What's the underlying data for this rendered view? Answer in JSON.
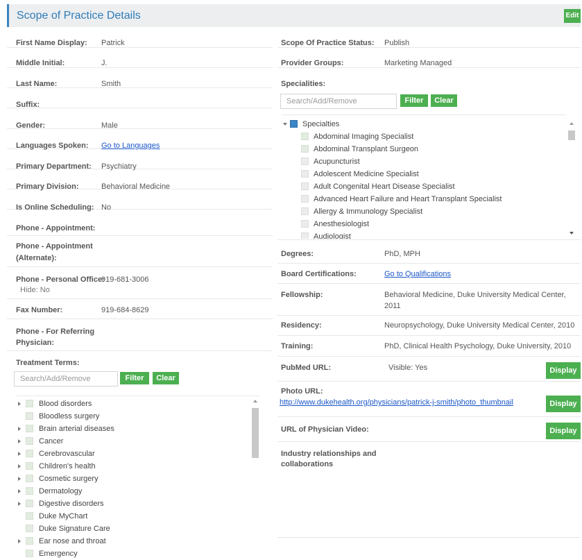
{
  "header": {
    "title": "Scope of Practice Details",
    "edit_label": "Edit"
  },
  "left": {
    "fields": [
      {
        "label": "First Name Display:",
        "value": "Patrick"
      },
      {
        "label": "Middle Initial:",
        "value": "J."
      },
      {
        "label": "Last Name:",
        "value": "Smith"
      },
      {
        "label": "Suffix:",
        "value": ""
      },
      {
        "label": "Gender:",
        "value": "Male"
      },
      {
        "label": "Languages Spoken:",
        "value": "Go to Languages"
      },
      {
        "label": "Primary Department:",
        "value": "Psychiatry"
      },
      {
        "label": "Primary Division:",
        "value": "Behavioral Medicine"
      },
      {
        "label": "Is Online Scheduling:",
        "value": "No"
      },
      {
        "label": "Phone - Appointment:",
        "value": ""
      },
      {
        "label_line1": "Phone - Appointment",
        "label_line2": "(Alternate):"
      },
      {
        "label": "Phone - Personal Office:",
        "value": "919-681-3006",
        "sub": "Hide: No"
      },
      {
        "label": "Fax Number:",
        "value": "919-684-8629"
      },
      {
        "label_line1": "Phone - For Referring",
        "label_line2": "Physician:"
      }
    ],
    "treatment": {
      "label": "Treatment Terms:",
      "placeholder": "Search/Add/Remove",
      "filter_label": "Filter",
      "clear_label": "Clear",
      "items": [
        "Blood disorders",
        "Bloodless surgery",
        "Brain arterial diseases",
        "Cancer",
        "Cerebrovascular",
        "Children's health",
        "Cosmetic surgery",
        "Dermatology",
        "Digestive disorders",
        "Duke MyChart",
        "Duke Signature Care",
        "Ear nose and throat",
        "Emergency"
      ]
    }
  },
  "right": {
    "fields": [
      {
        "label": "Scope Of Practice Status:",
        "value": "Publish"
      },
      {
        "label": "Provider Groups:",
        "value": "Marketing Managed"
      }
    ],
    "specialities": {
      "label": "Specialities:",
      "placeholder": "Search/Add/Remove",
      "filter_label": "Filter",
      "clear_label": "Clear",
      "root": "Specialties",
      "items": [
        "Abdominal Imaging Specialist",
        "Abdominal Transplant Surgeon",
        "Acupuncturist",
        "Adolescent Medicine Specialist",
        "Adult Congenital Heart Disease Specialist",
        "Advanced Heart Failure and Heart Transplant Specialist",
        "Allergy & Immunology Specialist",
        "Anesthesiologist",
        "Audiologist"
      ]
    },
    "degrees": {
      "label": "Degrees:",
      "value": "PhD, MPH"
    },
    "board": {
      "label": "Board Certifications:",
      "value": "Go to Qualifications"
    },
    "fellowship": {
      "label": "Fellowship:",
      "line1": "Behavioral Medicine, Duke University Medical Center,",
      "line2": "2011"
    },
    "residency": {
      "label": "Residency:",
      "value": "Neuropsychology, Duke University Medical Center, 2010"
    },
    "training": {
      "label": "Training:",
      "value": "PhD, Clinical Health Psychology, Duke University, 2010"
    },
    "pubmed": {
      "label": "PubMed URL:",
      "value": "Visible: Yes",
      "button": "Display"
    },
    "photo": {
      "label": "Photo URL:",
      "value": "http://www.dukehealth.org/physicians/patrick-j-smith/photo_thumbnail",
      "button": "Display"
    },
    "video": {
      "label": "URL of Physician Video:",
      "button": "Display"
    },
    "industry": {
      "line1": "Industry relationships and",
      "line2": "collaborations"
    }
  },
  "colors": {
    "accent": "#3b83c0",
    "button_green": "#4caf50",
    "link": "#1a56c8",
    "checkbox_checked": "#3a86c8"
  }
}
